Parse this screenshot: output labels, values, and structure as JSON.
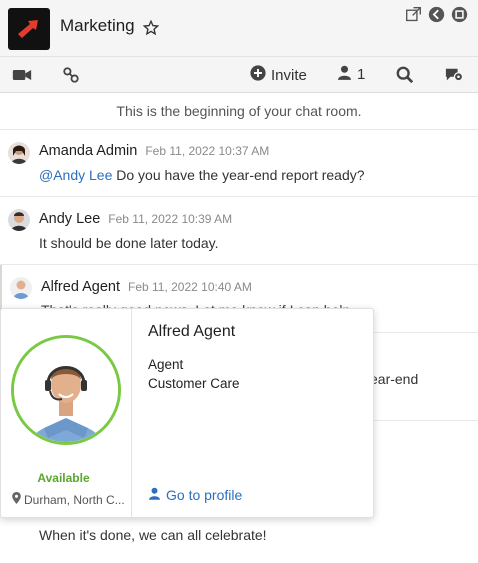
{
  "header": {
    "title": "Marketing",
    "icons": [
      "popout-icon",
      "back-icon",
      "minimize-icon"
    ]
  },
  "toolbar": {
    "invite_label": "Invite",
    "member_count": "1"
  },
  "chat": {
    "beginning_text": "This is the beginning of your chat room.",
    "messages": [
      {
        "author": "Amanda Admin",
        "time": "Feb 11, 2022 10:37 AM",
        "mention": "@Andy Lee",
        "text": " Do you have the year-end report ready?"
      },
      {
        "author": "Andy Lee",
        "time": "Feb 11, 2022 10:39 AM",
        "text": "It should be done later today."
      },
      {
        "author": "Alfred Agent",
        "time": "Feb 11, 2022 10:40 AM",
        "text": "That's really good news. Let me know if I can help."
      },
      {
        "partial_text": "ear-end"
      },
      {
        "text": "When it's done, we can all celebrate!"
      }
    ]
  },
  "profile_card": {
    "name": "Alfred Agent",
    "role": "Agent",
    "department": "Customer Care",
    "status": "Available",
    "location": "Durham, North C...",
    "link_label": "Go to profile",
    "status_color": "#7ac943"
  }
}
